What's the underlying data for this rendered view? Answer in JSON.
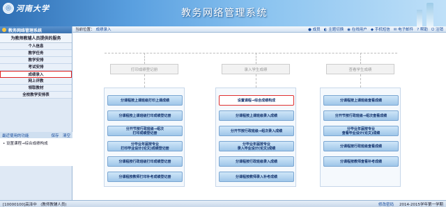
{
  "app": {
    "logo_text": "河南大学",
    "title": "教务网络管理系统"
  },
  "left": {
    "panel_title": "教务网络管理系统",
    "section_title": "为教师教辅人员提供的服务",
    "menu": [
      "个人信息",
      "教学任务",
      "教学安排",
      "考试安排",
      "成绩录入",
      "网上评教",
      "领取教材",
      "全校教学安排表"
    ],
    "active_index": 4,
    "recent": {
      "title": "最近使用的功能",
      "save": "保存",
      "clear": "清空",
      "items": [
        "设置课程→综合成绩构成"
      ]
    }
  },
  "topbar": {
    "location_label": "当前位置：",
    "location_value": "成绩录入",
    "tools": [
      "成员",
      "主题切换",
      "在线用户",
      "手机短信",
      "电子邮件",
      "帮助",
      "注销"
    ]
  },
  "columns": [
    {
      "header": "打印成绩登记册",
      "buttons": [
        "分课程按上课班级打印上课成绩",
        "分课程按上课班级打印成绩登记册",
        "分开节按行政班级→组次\n打印成绩登记册",
        "分毕业年届按专业\n打印毕业设计(论文)成绩登记册",
        "分课程按行政班级打印成绩登记册",
        "分课程按教师打印补考成绩登记册"
      ]
    },
    {
      "header": "录入学生成绩",
      "buttons": [
        "设置课程→综合成绩构成",
        "分课程按上课班级录入成绩",
        "分开节按行政班级→组次录入成绩",
        "分毕业年届按专业\n录入毕业设计(论文)成绩",
        "分课程按行政班级录入成绩",
        "分课程按教师录入补考成绩"
      ],
      "active_button": 0
    },
    {
      "header": "查看学生成绩",
      "buttons": [
        "分课程按上课班级查看成绩",
        "分开节按行政班级→组次查看成绩",
        "分毕业年届按专业\n查看毕业设计(论文)成绩",
        "分课程按行政班级查看成绩",
        "分课程按教师查看补考成绩"
      ]
    }
  ],
  "status": {
    "left": "[10000100]高泽中　(教师教辅人员)",
    "right": [
      "修改密码",
      "2014-2015学年第一学期"
    ]
  }
}
